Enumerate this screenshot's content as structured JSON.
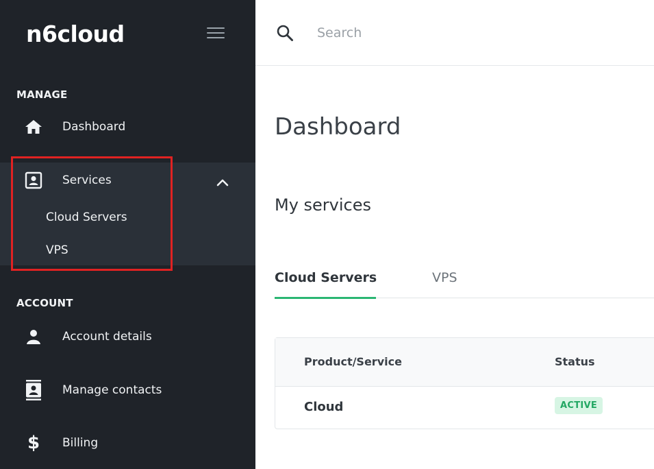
{
  "brand": {
    "logo_text": "n6cloud"
  },
  "sidebar": {
    "sections": [
      {
        "label": "MANAGE"
      },
      {
        "label": "ACCOUNT"
      }
    ],
    "items": [
      {
        "label": "Dashboard",
        "icon": "home-icon"
      },
      {
        "label": "Services",
        "icon": "contact-card-icon",
        "expanded": true,
        "children": [
          {
            "label": "Cloud Servers"
          },
          {
            "label": "VPS"
          }
        ]
      },
      {
        "label": "Account details",
        "icon": "user-icon"
      },
      {
        "label": "Manage contacts",
        "icon": "contacts-book-icon"
      },
      {
        "label": "Billing",
        "icon": "dollar-icon"
      }
    ]
  },
  "topbar": {
    "search_placeholder": "Search"
  },
  "main": {
    "title": "Dashboard",
    "section_title": "My services",
    "tabs": [
      {
        "label": "Cloud Servers",
        "active": true
      },
      {
        "label": "VPS",
        "active": false
      }
    ],
    "table": {
      "columns": [
        "Product/Service",
        "Status"
      ],
      "rows": [
        {
          "product": "Cloud",
          "status": "ACTIVE"
        }
      ]
    }
  },
  "colors": {
    "sidebar_bg": "#1f2329",
    "accent_green": "#2bb673",
    "highlight_red": "#e02222",
    "badge_bg": "#d7f5e4",
    "badge_text": "#22a763"
  }
}
